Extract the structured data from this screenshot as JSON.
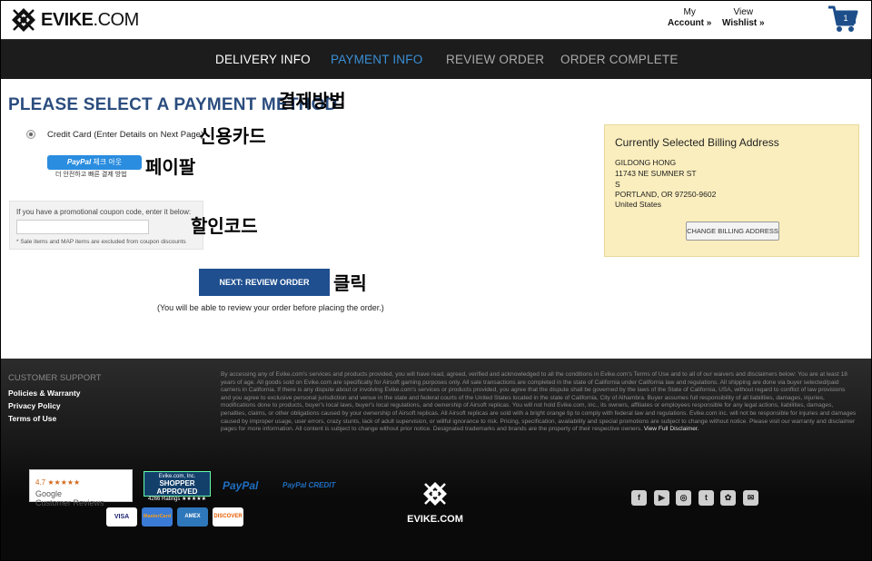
{
  "header": {
    "logo_text": "EVIKE",
    "logo_suffix": ".COM",
    "account_line1": "My",
    "account_line2": "Account",
    "wishlist_line1": "View",
    "wishlist_line2": "Wishlist",
    "chevron": "»",
    "cart_count": "1"
  },
  "steps": [
    {
      "label": "DELIVERY INFO",
      "state": "done"
    },
    {
      "label": "PAYMENT INFO",
      "state": "active"
    },
    {
      "label": "REVIEW ORDER",
      "state": "upcoming"
    },
    {
      "label": "ORDER COMPLETE",
      "state": "upcoming"
    }
  ],
  "payment": {
    "title": "PLEASE SELECT A PAYMENT METHOD",
    "credit_card_label": "Credit Card (Enter Details on Next Page)",
    "paypal_button_brand": "PayPal",
    "paypal_button_text": "체크 아웃",
    "paypal_sub": "더 안전하고 빠른 결제 방법",
    "coupon_label": "If you have a promotional coupon code, enter it below:",
    "coupon_value": "",
    "coupon_note": "* Sale items and MAP items are excluded from coupon discounts",
    "next_button": "NEXT: REVIEW ORDER",
    "next_note": "(You will be able to review your order before placing the order.)"
  },
  "annotations": {
    "method": "결제방법",
    "card": "신용카드",
    "paypal": "페이팔",
    "coupon": "할인코드",
    "click": "클릭"
  },
  "billing": {
    "title": "Currently Selected Billing Address",
    "name": "GILDONG HONG",
    "street": "11743 NE SUMNER ST",
    "line2": "S",
    "city": "PORTLAND, OR 97250-9602",
    "country": "United States",
    "change_button": "CHANGE BILLING ADDRESS"
  },
  "footer": {
    "support_title": "CUSTOMER SUPPORT",
    "links": [
      "Policies & Warranty",
      "Privacy Policy",
      "Terms of Use"
    ],
    "legal_text": "By accessing any of Evike.com's services and products provided, you will have read, agreed, verified and acknowledged to all the conditions in Evike.com's Terms of Use and to all of our waivers and disclaimers below: You are at least 18 years of age. All goods sold on Evike.com are specifically for Airsoft gaming purposes only. All sale transactions are completed in the state of California under California law and regulations. All shipping are done via buyer selected/paid carriers in California. If there is any dispute about or involving Evike.com's services or products provided, you agree that the dispute shall be governed by the laws of the State of California, USA, without regard to conflict of law provisions and you agree to exclusive personal jurisdiction and venue in the state and federal courts of the United States located in the state of California, City of Alhambra. Buyer assumes full responsibility of all liabilities, damages, injuries, modifications done to products, buyer's local laws, buyer's local regulations, and ownership of Airsoft replicas. You will not hold Evike.com, inc., its owners, affiliates or employees responsible for any legal actions, liabilities, damages, penalties, claims, or other obligations caused by your ownership of Airsoft replicas. All Airsoft replicas are sold with a bright orange tip to comply with federal law and regulations. Evike.com inc. will not be responsible for injuries and damages caused by improper usage, user errors, crazy stunts, lack of adult supervision, or willful ignorance to risk. Pricing, specification, availability and special promotions are subject to change without notice. Please visit our warranty and disclaimer pages for more information. All content is subject to change without prior notice. Designated trademarks and brands are the property of their respective owners.",
    "view_disclaimer": "View Full Disclaimer.",
    "google_rating": "4.7 ★★★★★",
    "google_name": "Google",
    "google_sub": "Customer Reviews",
    "shopper_line1": "Evike.com, Inc.",
    "shopper_line2": "SHOPPER APPROVED",
    "shopper_line3": "4266 Ratings ★★★★★",
    "paypal_logo": "PayPal",
    "paypal_credit": "PayPal CREDIT",
    "cards": [
      "VISA",
      "MasterCard",
      "AMEX",
      "DISCOVER"
    ],
    "footer_logo": "EVIKE.COM",
    "social": [
      "f",
      "▶",
      "◎",
      "t",
      "✿",
      "✉"
    ]
  }
}
